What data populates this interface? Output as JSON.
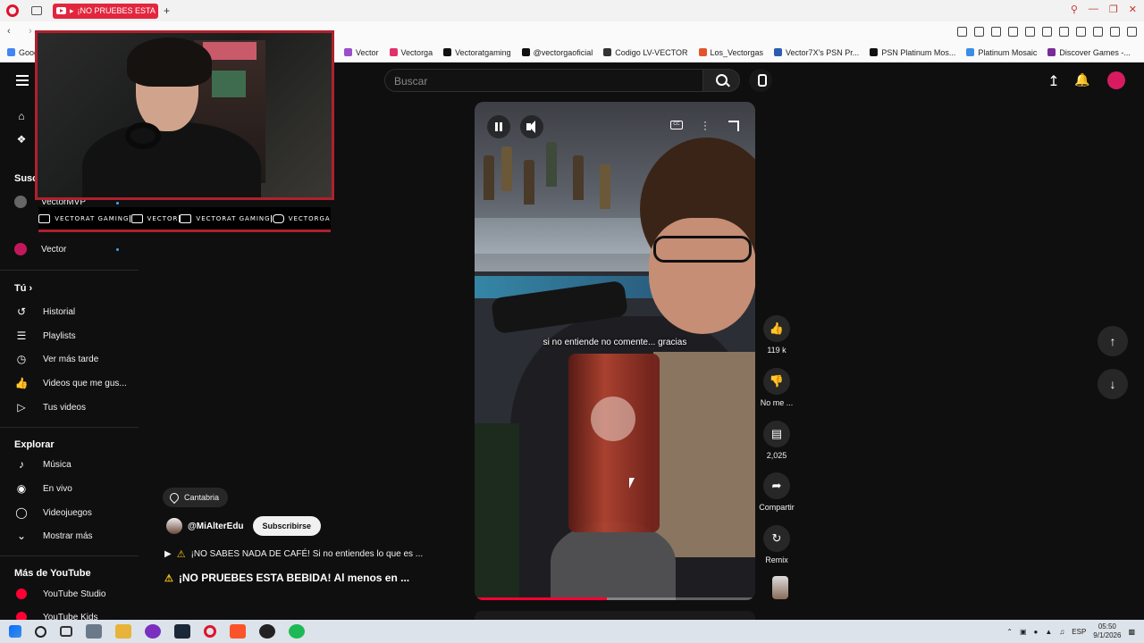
{
  "browser": {
    "tab_title": "¡NO PRUEBES ESTA",
    "bookmarks": [
      {
        "label": "Goog",
        "color": "#4285f4"
      },
      {
        "label": "Vector",
        "color": "#9b4dca"
      },
      {
        "label": "Vectorga",
        "color": "#e1306c"
      },
      {
        "label": "Vectoratgaming",
        "color": "#111111"
      },
      {
        "label": "@vectorgaoficial",
        "color": "#111111"
      },
      {
        "label": "Codigo LV-VECTOR",
        "color": "#333333"
      },
      {
        "label": "Los_Vectorgas",
        "color": "#e2552b"
      },
      {
        "label": "Vector7X's PSN Pr...",
        "color": "#2a5db0"
      },
      {
        "label": "PSN Platinum Mos...",
        "color": "#111111"
      },
      {
        "label": "Platinum Mosaic",
        "color": "#3a8ee6"
      },
      {
        "label": "Discover Games -...",
        "color": "#7a2a9a"
      }
    ]
  },
  "header": {
    "search_placeholder": "Buscar"
  },
  "sidebar": {
    "subs_heading": "Susc",
    "subs": [
      {
        "label": "VectorMVP"
      },
      {
        "label": "Vector"
      }
    ],
    "you_heading": "Tú",
    "you_items": [
      {
        "label": "Historial",
        "icon": "history-icon"
      },
      {
        "label": "Playlists",
        "icon": "playlists-icon"
      },
      {
        "label": "Ver más tarde",
        "icon": "watch-later-icon"
      },
      {
        "label": "Videos que me gus...",
        "icon": "liked-icon"
      },
      {
        "label": "Tus videos",
        "icon": "your-videos-icon"
      }
    ],
    "explore_heading": "Explorar",
    "explore_items": [
      {
        "label": "Música",
        "icon": "music-icon"
      },
      {
        "label": "En vivo",
        "icon": "live-icon"
      },
      {
        "label": "Videojuegos",
        "icon": "gaming-icon"
      },
      {
        "label": "Mostrar más",
        "icon": "chevron-down-icon"
      }
    ],
    "more_heading": "Más de YouTube",
    "more_items": [
      {
        "label": "YouTube Studio"
      },
      {
        "label": "YouTube Kids"
      }
    ]
  },
  "overlay": {
    "socials": [
      {
        "label": "VECTORAT GAMING",
        "icon": "youtube-icon"
      },
      {
        "label": "VECTOR",
        "icon": "twitch-icon"
      },
      {
        "label": "VECTORAT GAMING",
        "icon": "twitter-icon"
      },
      {
        "label": "VECTORGA",
        "icon": "instagram-icon"
      }
    ]
  },
  "video": {
    "caption": "si no entiende no comente... gracias",
    "progress": 0.47,
    "location": "Cantabria",
    "channel": "@MiAlterEdu",
    "subscribe_label": "Subscribirse",
    "playlist_text": "¡NO SABES NADA DE CAFÉ! Si no entiendes lo que es ...",
    "title": "¡NO PRUEBES ESTA BEBIDA! Al menos en ..."
  },
  "actions": {
    "likes": "119 k",
    "dislike_label": "No me ...",
    "comments": "2,025",
    "share_label": "Compartir",
    "remix_label": "Remix"
  },
  "taskbar": {
    "lang": "ESP",
    "time": "05:50",
    "date": "9/1/2026"
  },
  "colors": {
    "accent": "#ff0033",
    "opera_red": "#e0132c",
    "link_blue": "#3ea6ff"
  }
}
